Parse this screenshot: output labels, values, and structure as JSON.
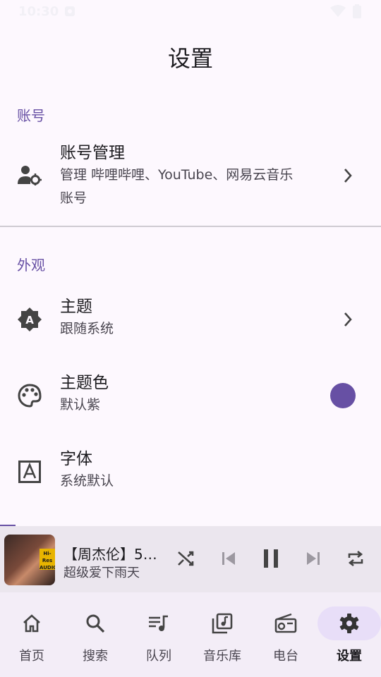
{
  "status_bar": {
    "time": "10:30",
    "notification_icon": "app-notification-icon",
    "wifi_icon": "wifi-icon",
    "battery_icon": "battery-icon"
  },
  "page": {
    "title": "设置"
  },
  "sections": {
    "account": {
      "label": "账号",
      "items": [
        {
          "title": "账号管理",
          "subtitle": "管理 哔哩哔哩、YouTube、网易云音乐 账号",
          "icon": "manage-accounts-icon"
        }
      ]
    },
    "appearance": {
      "label": "外观",
      "items": [
        {
          "title": "主题",
          "subtitle": "跟随系统",
          "icon": "brightness-auto-icon"
        },
        {
          "title": "主题色",
          "subtitle": "默认紫",
          "icon": "palette-icon",
          "swatch_color": "#6750a4"
        },
        {
          "title": "字体",
          "subtitle": "系统默认",
          "icon": "font-icon"
        }
      ]
    }
  },
  "player": {
    "title": "【周杰伦】5…",
    "artist": "超级爱下雨天",
    "playback_progress": 0.04,
    "album_badge": "Hi-Res AUDIO",
    "controls": [
      "shuffle-icon",
      "skip-previous-icon",
      "pause-icon",
      "skip-next-icon",
      "repeat-icon"
    ]
  },
  "nav": {
    "items": [
      {
        "label": "首页",
        "icon": "home-icon"
      },
      {
        "label": "搜索",
        "icon": "search-icon"
      },
      {
        "label": "队列",
        "icon": "queue-music-icon"
      },
      {
        "label": "音乐库",
        "icon": "library-music-icon"
      },
      {
        "label": "电台",
        "icon": "radio-icon"
      },
      {
        "label": "设置",
        "icon": "settings-icon",
        "active": true
      }
    ]
  },
  "colors": {
    "accent": "#6750a4",
    "background": "#fdf8fe",
    "nav_active": "#e8def8"
  }
}
